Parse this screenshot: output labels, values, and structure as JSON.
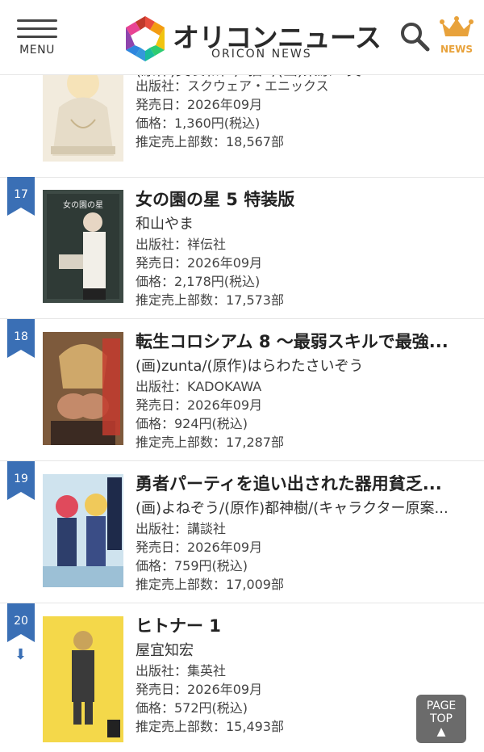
{
  "header": {
    "menu_label": "MENU",
    "logo_title": "オリコンニュース",
    "logo_subtitle": "ORICON NEWS",
    "news_label": "NEWS"
  },
  "items": [
    {
      "rank": "",
      "title": "",
      "author": "(原作)美袋和仁,n猫R/(画)栗原一実",
      "publisher": "出版社：スクウェア・エニックス",
      "release": "発売日：2026年09月",
      "price": "価格：1,360円(税込)",
      "sales": "推定売上部数：18,567部"
    },
    {
      "rank": "17",
      "title": "女の園の星 5 特装版",
      "author": "和山やま",
      "publisher": "出版社：祥伝社",
      "release": "発売日：2026年09月",
      "price": "価格：2,178円(税込)",
      "sales": "推定売上部数：17,573部"
    },
    {
      "rank": "18",
      "title": "転生コロシアム 8 ～最弱スキルで最強...",
      "author": "(画)zunta/(原作)はらわたさいぞう",
      "publisher": "出版社：KADOKAWA",
      "release": "発売日：2026年09月",
      "price": "価格：924円(税込)",
      "sales": "推定売上部数：17,287部"
    },
    {
      "rank": "19",
      "title": "勇者パーティを追い出された器用貧乏...",
      "author": "(画)よねぞう/(原作)都神樹/(キャラクター原案...",
      "publisher": "出版社：講談社",
      "release": "発売日：2026年09月",
      "price": "価格：759円(税込)",
      "sales": "推定売上部数：17,009部"
    },
    {
      "rank": "20",
      "title": "ヒトナー 1",
      "author": "屋宜知宏",
      "publisher": "出版社：集英社",
      "release": "発売日：2026年09月",
      "price": "価格：572円(税込)",
      "sales": "推定売上部数：15,493部"
    }
  ],
  "page_top": {
    "line1": "PAGE",
    "line2": "TOP",
    "arrow": "▲"
  },
  "colors": {
    "rank_ribbon": "#3a6fb5",
    "news_accent": "#e8a23b",
    "page_top_bg": "#6b6b6b"
  },
  "icons": {
    "menu": "hamburger-icon",
    "search": "search-icon",
    "news": "crown-icon",
    "down": "down-arrow-icon"
  }
}
